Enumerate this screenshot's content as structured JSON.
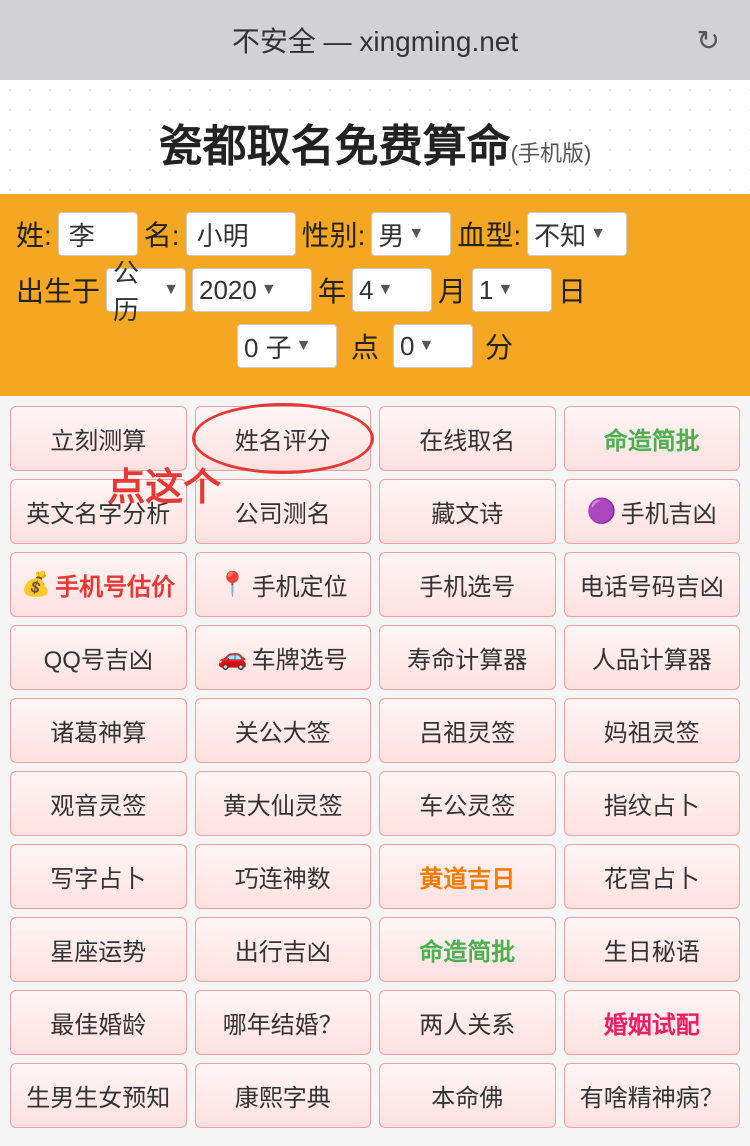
{
  "browser": {
    "title": "不安全 — xingming.net",
    "refresh_icon": "↻"
  },
  "page": {
    "title": "瓷都取名免费算命",
    "subtitle": "(手机版)"
  },
  "form": {
    "surname_label": "姓:",
    "surname_value": "李",
    "name_label": "名:",
    "name_value": "小明",
    "gender_label": "性别:",
    "gender_value": "男",
    "blood_label": "血型:",
    "blood_value": "不知",
    "born_label": "出生于",
    "calendar_value": "公历",
    "year_value": "2020",
    "year_label": "年",
    "month_value": "4",
    "month_label": "月",
    "day_value": "1",
    "day_label": "日",
    "hour_value": "0 子",
    "dot_label": "点",
    "minute_value": "0",
    "minute_label": "分"
  },
  "buttons": [
    [
      {
        "label": "立刻测算",
        "style": "normal"
      },
      {
        "label": "姓名评分",
        "style": "circled"
      },
      {
        "label": "在线取名",
        "style": "normal"
      },
      {
        "label": "命造简批",
        "style": "green"
      }
    ],
    [
      {
        "label": "英文名字分析",
        "style": "normal"
      },
      {
        "label": "公司测名",
        "style": "normal"
      },
      {
        "label": "藏文诗",
        "style": "normal"
      },
      {
        "label": "🟣 手机吉凶",
        "style": "normal",
        "emoji": true
      }
    ],
    [
      {
        "label": "💰 手机号估价",
        "style": "red",
        "emoji": true
      },
      {
        "label": "📍 手机定位",
        "style": "normal",
        "emoji": true
      },
      {
        "label": "手机选号",
        "style": "normal"
      },
      {
        "label": "电话号码吉凶",
        "style": "normal"
      }
    ],
    [
      {
        "label": "QQ号吉凶",
        "style": "normal"
      },
      {
        "label": "🚗 车牌选号",
        "style": "normal",
        "emoji": true
      },
      {
        "label": "寿命计算器",
        "style": "normal"
      },
      {
        "label": "人品计算器",
        "style": "normal"
      }
    ],
    [
      {
        "label": "诸葛神算",
        "style": "normal"
      },
      {
        "label": "关公大签",
        "style": "normal"
      },
      {
        "label": "吕祖灵签",
        "style": "normal"
      },
      {
        "label": "妈祖灵签",
        "style": "normal"
      }
    ],
    [
      {
        "label": "观音灵签",
        "style": "normal"
      },
      {
        "label": "黄大仙灵签",
        "style": "normal"
      },
      {
        "label": "车公灵签",
        "style": "normal"
      },
      {
        "label": "指纹占卜",
        "style": "normal"
      }
    ],
    [
      {
        "label": "写字占卜",
        "style": "normal"
      },
      {
        "label": "巧连神数",
        "style": "normal"
      },
      {
        "label": "黄道吉日",
        "style": "orange"
      },
      {
        "label": "花宫占卜",
        "style": "normal"
      }
    ],
    [
      {
        "label": "星座运势",
        "style": "normal"
      },
      {
        "label": "出行吉凶",
        "style": "normal"
      },
      {
        "label": "命造简批",
        "style": "green"
      },
      {
        "label": "生日秘语",
        "style": "normal"
      }
    ],
    [
      {
        "label": "最佳婚龄",
        "style": "normal"
      },
      {
        "label": "哪年结婚？",
        "style": "normal"
      },
      {
        "label": "两人关系",
        "style": "normal"
      },
      {
        "label": "婚姻试配",
        "style": "pink"
      }
    ],
    [
      {
        "label": "生男生女预知",
        "style": "normal"
      },
      {
        "label": "康熙字典",
        "style": "normal"
      },
      {
        "label": "本命佛",
        "style": "normal"
      },
      {
        "label": "有啥精神病？",
        "style": "normal"
      }
    ]
  ],
  "annotation": {
    "click_here": "点这个"
  }
}
